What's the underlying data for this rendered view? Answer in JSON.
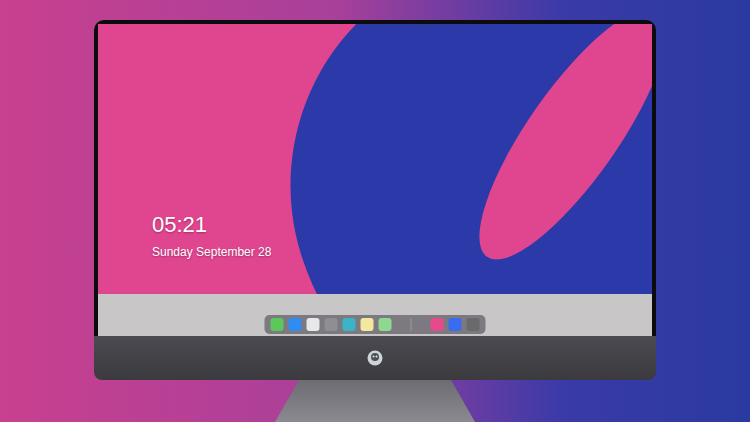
{
  "lock_screen": {
    "time": "05:21",
    "date": "Sunday September 28"
  },
  "dock": {
    "items": [
      {
        "kind": "app",
        "color": "#5ac85a"
      },
      {
        "kind": "app",
        "color": "#2f8cf0"
      },
      {
        "kind": "app",
        "color": "#e8e8e8"
      },
      {
        "kind": "app",
        "color": "#8e8e93"
      },
      {
        "kind": "app",
        "color": "#3cb4c8"
      },
      {
        "kind": "app",
        "color": "#f4e7a0"
      },
      {
        "kind": "app",
        "color": "#8fd88f"
      },
      {
        "kind": "separator",
        "color": "#9a9aa0"
      },
      {
        "kind": "app",
        "color": "#e64a8c"
      },
      {
        "kind": "app",
        "color": "#3a6cf0"
      },
      {
        "kind": "app",
        "color": "#6a6a6a"
      }
    ]
  }
}
